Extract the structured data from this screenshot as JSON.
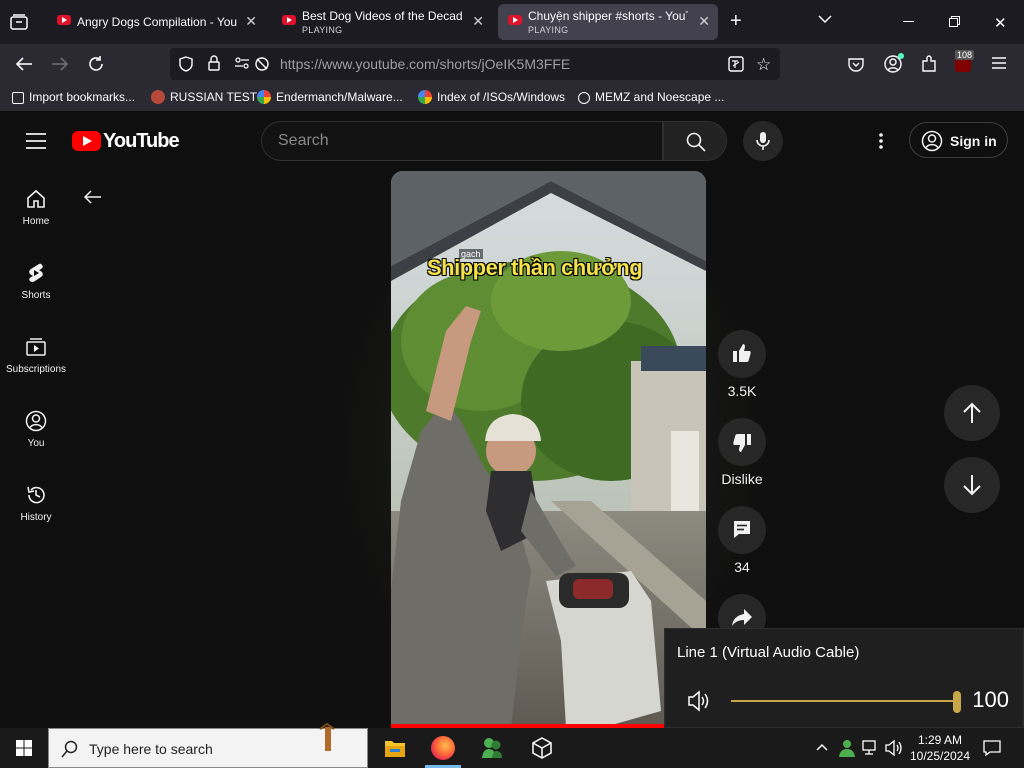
{
  "browser": {
    "tabs": [
      {
        "title": "Angry Dogs Compilation - YouTube",
        "status": "",
        "active": false
      },
      {
        "title": "Best Dog Videos of the Decade",
        "status": "PLAYING",
        "active": false
      },
      {
        "title": "Chuyện shipper #shorts - YouTube",
        "status": "PLAYING",
        "active": true
      }
    ],
    "url": "https://www.youtube.com/shorts/jOeIK5M3FFE",
    "notification_badge": "108",
    "bookmarks": [
      {
        "label": "Import bookmarks...",
        "icon": "import-icon"
      },
      {
        "label": "RUSSIAN TEST",
        "icon": "russian-test-favicon"
      },
      {
        "label": "Endermanch/Malware...",
        "icon": "google-favicon"
      },
      {
        "label": "Index of /ISOs/Windows",
        "icon": "google-favicon"
      },
      {
        "label": "MEMZ and Noescape ...",
        "icon": "globe-icon"
      }
    ]
  },
  "youtube": {
    "logo_text": "YouTube",
    "search_placeholder": "Search",
    "signin_label": "Sign in",
    "sidebar": [
      {
        "label": "Home",
        "icon": "home-icon"
      },
      {
        "label": "Shorts",
        "icon": "shorts-icon"
      },
      {
        "label": "Subscriptions",
        "icon": "subscriptions-icon"
      },
      {
        "label": "You",
        "icon": "you-icon"
      },
      {
        "label": "History",
        "icon": "history-icon"
      }
    ],
    "video": {
      "caption": "Shipper thần chưởng",
      "small_caption": "gạch"
    },
    "actions": {
      "likes": "3.5K",
      "dislike_label": "Dislike",
      "comments": "34"
    }
  },
  "volume_flyout": {
    "device": "Line 1 (Virtual Audio Cable)",
    "level": 100,
    "accent": "#c8a64a"
  },
  "taskbar": {
    "search_placeholder": "Type here to search",
    "time": "1:29 AM",
    "date": "10/25/2024"
  }
}
